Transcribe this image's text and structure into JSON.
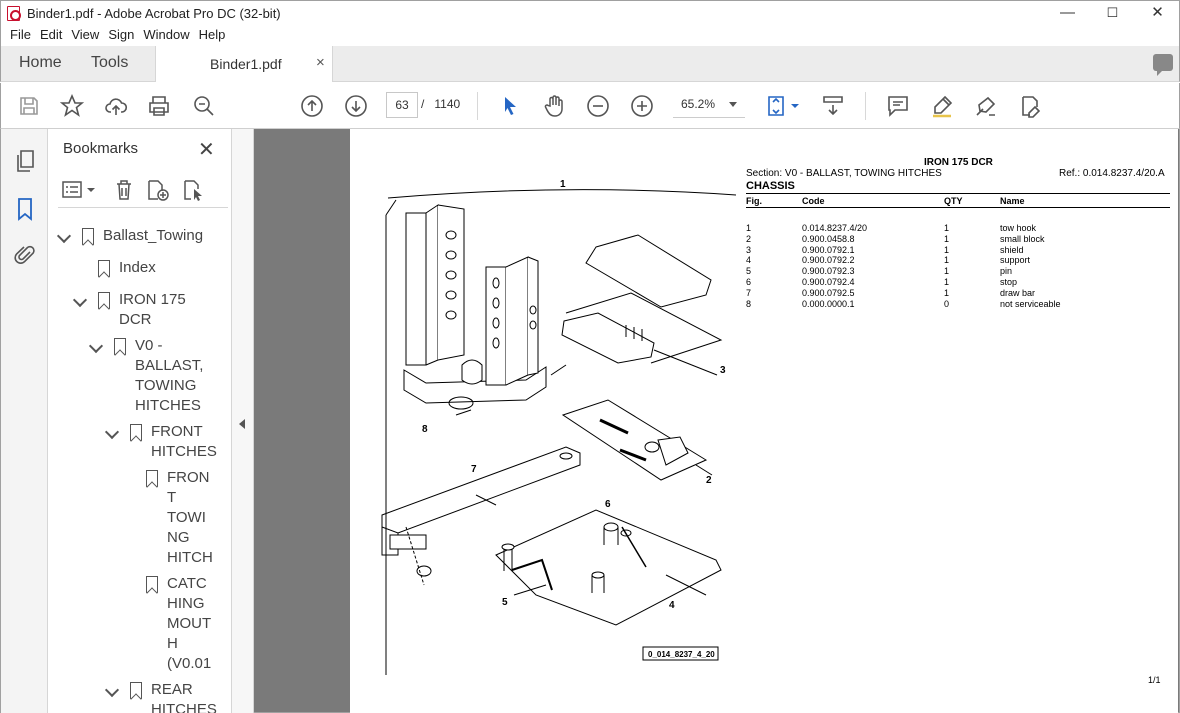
{
  "window": {
    "title": "Binder1.pdf - Adobe Acrobat Pro DC (32-bit)",
    "minimize": "—",
    "maximize": "☐",
    "close": "✕"
  },
  "menu": [
    "File",
    "Edit",
    "View",
    "Sign",
    "Window",
    "Help"
  ],
  "tabs": {
    "home": "Home",
    "tools": "Tools",
    "document": "Binder1.pdf",
    "close": "×"
  },
  "toolbar": {
    "current_page": "63",
    "page_separator": "/",
    "total_pages": "1140",
    "zoom": "65.2%"
  },
  "bookmarks": {
    "title": "Bookmarks",
    "close": "✕",
    "items": [
      {
        "label": "Ballast_Towing"
      },
      {
        "label": "Index"
      },
      {
        "label": "IRON 175 DCR",
        "lines": [
          "IRON 175",
          "DCR"
        ]
      },
      {
        "label": "V0 - BALLAST, TOWING HITCHES",
        "lines": [
          "V0 -",
          "BALLAST,",
          "TOWING",
          "HITCHES"
        ]
      },
      {
        "label": "FRONT HITCHES",
        "lines": [
          "FRONT",
          "HITCHES"
        ]
      },
      {
        "label": "FRONT TOWING HITCH",
        "lines": [
          "FRON",
          "T",
          "TOWI",
          "NG",
          "HITCH"
        ]
      },
      {
        "label": "CATCHING MOUTH (V0.01",
        "lines": [
          "CATC",
          "HING",
          "MOUT",
          "H",
          "(V0.01"
        ]
      },
      {
        "label": "REAR HITCHES",
        "lines": [
          "REAR",
          "HITCHES"
        ]
      }
    ]
  },
  "document": {
    "model": "IRON 175 DCR",
    "section": "Section: V0 - BALLAST, TOWING HITCHES",
    "ref": "Ref.: 0.014.8237.4/20.A",
    "group": "CHASSIS",
    "columns": [
      "Fig.",
      "Code",
      "QTY",
      "Name"
    ],
    "parts": [
      [
        "1",
        "0.014.8237.4/20",
        "1",
        "tow hook"
      ],
      [
        "2",
        "0.900.0458.8",
        "1",
        "small block"
      ],
      [
        "3",
        "0.900.0792.1",
        "1",
        "shield"
      ],
      [
        "4",
        "0.900.0792.2",
        "1",
        "support"
      ],
      [
        "5",
        "0.900.0792.3",
        "1",
        "pin"
      ],
      [
        "6",
        "0.900.0792.4",
        "1",
        "stop"
      ],
      [
        "7",
        "0.900.0792.5",
        "1",
        "draw bar"
      ],
      [
        "8",
        "0.000.0000.1",
        "0",
        "not serviceable"
      ]
    ],
    "callouts": [
      "1",
      "2",
      "3",
      "4",
      "5",
      "6",
      "7",
      "8"
    ],
    "figure_id": "0_014_8237_4_20",
    "page_label": "1/1"
  }
}
